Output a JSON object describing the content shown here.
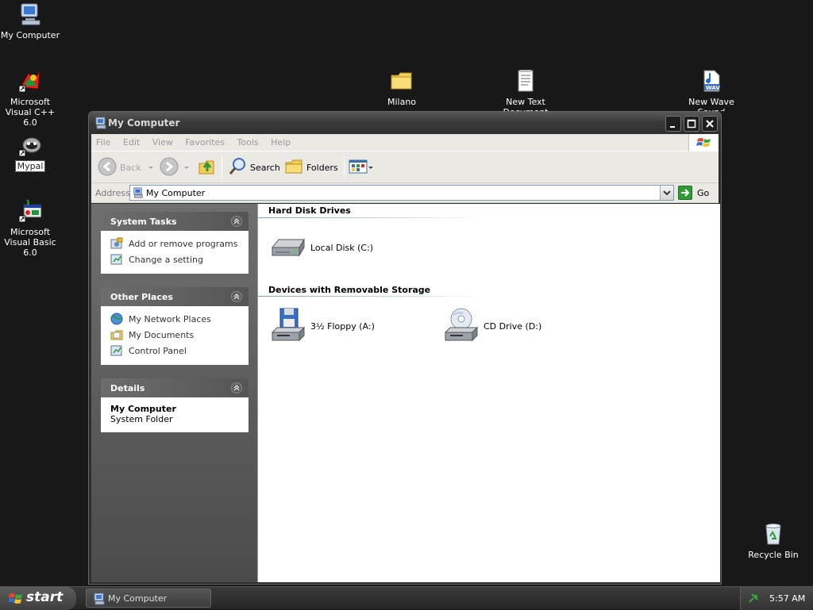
{
  "desktop": {
    "icons": [
      {
        "label": "My Computer",
        "icon": "my-computer-icon"
      },
      {
        "label": "Microsoft Visual C++ 6.0",
        "icon": "visual-cpp-icon"
      },
      {
        "label": "Mypal",
        "icon": "mypal-icon",
        "selected": true
      },
      {
        "label": "Microsoft Visual Basic 6.0",
        "icon": "visual-basic-icon"
      },
      {
        "label": "Milano",
        "icon": "folder-icon"
      },
      {
        "label": "New Text Document",
        "icon": "text-document-icon"
      },
      {
        "label": "New Wave Sound",
        "icon": "wav-file-icon"
      },
      {
        "label": "Recycle Bin",
        "icon": "recycle-bin-icon"
      }
    ]
  },
  "window": {
    "title": "My Computer",
    "menu": [
      "File",
      "Edit",
      "View",
      "Favorites",
      "Tools",
      "Help"
    ],
    "toolbar": {
      "back": "Back",
      "search": "Search",
      "folders": "Folders"
    },
    "address": {
      "label": "Address",
      "value": "My Computer",
      "go": "Go"
    },
    "left_pane": {
      "system_tasks": {
        "title": "System Tasks",
        "items": [
          "Add or remove programs",
          "Change a setting"
        ]
      },
      "other_places": {
        "title": "Other Places",
        "items": [
          "My Network Places",
          "My Documents",
          "Control Panel"
        ]
      },
      "details": {
        "title": "Details",
        "name": "My Computer",
        "type": "System Folder"
      }
    },
    "content": {
      "groups": [
        {
          "title": "Hard Disk Drives",
          "items": [
            {
              "label": "Local Disk (C:)",
              "icon": "hard-disk-icon"
            }
          ]
        },
        {
          "title": "Devices with Removable Storage",
          "items": [
            {
              "label": "3½ Floppy (A:)",
              "icon": "floppy-drive-icon"
            },
            {
              "label": "CD Drive (D:)",
              "icon": "cd-drive-icon"
            }
          ]
        }
      ]
    }
  },
  "taskbar": {
    "start": "start",
    "task": "My Computer",
    "clock": "5:57 AM"
  },
  "colors": {
    "desktop": "#181818",
    "window_title": "#3a3a3a",
    "menu_bg": "#ebe9e3",
    "pane_bg": "#5a5a5a"
  }
}
